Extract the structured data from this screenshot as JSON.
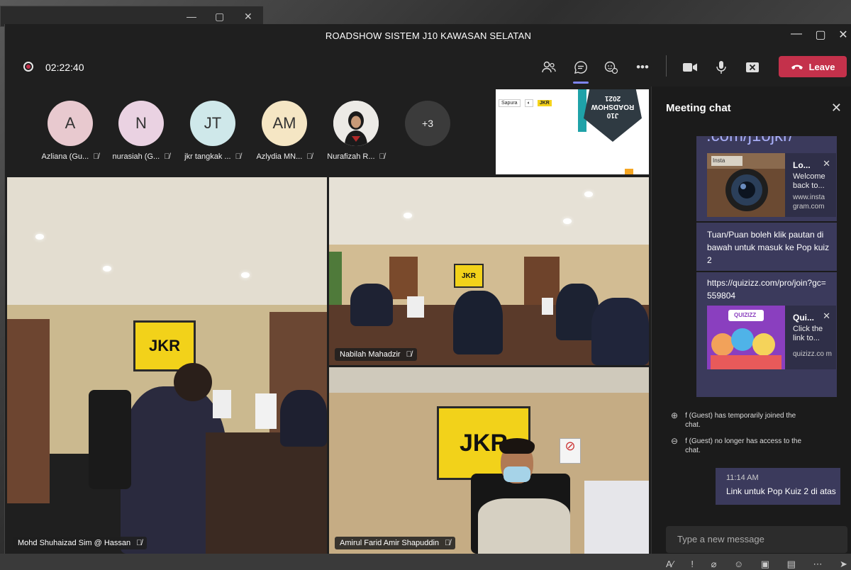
{
  "window": {
    "title": "ROADSHOW SISTEM J10 KAWASAN SELATAN"
  },
  "toolbar": {
    "timer": "02:22:40",
    "leave_label": "Leave",
    "icons": [
      "people-icon",
      "chat-icon",
      "reactions-icon",
      "more-icon",
      "camera-icon",
      "mic-icon",
      "share-tray-icon"
    ]
  },
  "attendees": [
    {
      "initials": "A",
      "name": "Azliana (Gu...",
      "color": "#e8c9cf"
    },
    {
      "initials": "N",
      "name": "nurasiah (G...",
      "color": "#ead2e2"
    },
    {
      "initials": "JT",
      "name": "jkr tangkak ...",
      "color": "#cfe8ea"
    },
    {
      "initials": "AM",
      "name": "Azlydia MN...",
      "color": "#f5e6c4"
    },
    {
      "initials": "",
      "name": "Nurafizah R...",
      "color": "#f2f2f2"
    }
  ],
  "more_attendees": "+3",
  "shared_screen": {
    "badge_text": "J10 ROADSHOW 2021",
    "logos": [
      "Sapura",
      "JKR"
    ]
  },
  "videos": [
    {
      "name": "Mohd Shuhaizad Sim @ Hassan"
    },
    {
      "name": "Nabilah Mahadzir"
    },
    {
      "name": "Amirul Farid Amir Shapuddin"
    }
  ],
  "chat": {
    "header": "Meeting chat",
    "top_link_fragment": ".com/j1ojkr/",
    "card1": {
      "title": "Lo...",
      "desc": "Welcome back to...",
      "url": "www.insta gram.com",
      "thumb_label": "Insta"
    },
    "message1": "Tuan/Puan boleh klik pautan di bawah untuk masuk ke Pop kuiz 2",
    "link2": "https://quizizz.com/pro/join?gc=559804",
    "card2": {
      "title": "Qui...",
      "desc": "Click the link to...",
      "url": "quizizz.co m",
      "thumb_label": "QUIZIZZ"
    },
    "system1": "f (Guest) has temporarily joined the chat.",
    "system2": "f (Guest) no longer has access to the chat.",
    "my_time": "11:14 AM",
    "my_message": "Link untuk Pop Kuiz 2 di atas",
    "composer_placeholder": "Type a new message"
  },
  "colors": {
    "accent": "#7f85f5",
    "leave": "#c4314b",
    "bubble": "#3b3a5c",
    "jkr_yellow": "#f2d21a"
  }
}
